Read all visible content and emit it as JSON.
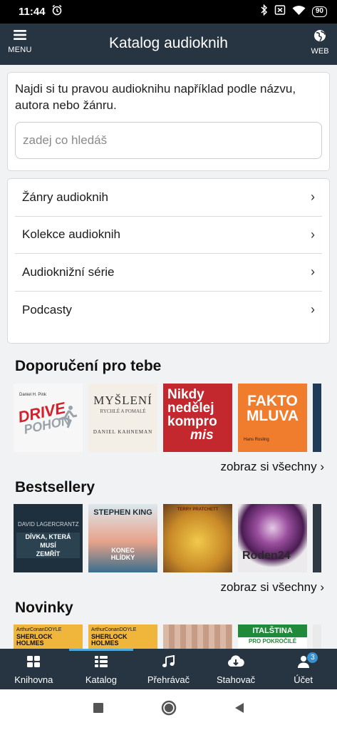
{
  "status": {
    "time": "11:44",
    "battery": "90"
  },
  "appbar": {
    "menu_label": "MENU",
    "title": "Katalog audioknih",
    "web_label": "WEB"
  },
  "search": {
    "intro": "Najdi si tu pravou audioknihu například podle názvu, autora nebo žánru.",
    "placeholder": "zadej co hledáš"
  },
  "nav": {
    "items": [
      {
        "label": "Žánry audioknih"
      },
      {
        "label": "Kolekce audioknih"
      },
      {
        "label": "Audioknižní série"
      },
      {
        "label": "Podcasty"
      }
    ]
  },
  "sections": [
    {
      "title": "Doporučení pro tebe",
      "see_all": "zobraz si všechny",
      "covers": [
        {
          "author": "Daniel H. Pink",
          "title_a": "DRIVE",
          "title_b": "POHON"
        },
        {
          "title_a": "MYŠLENÍ",
          "title_b": "RYCHLÉ A POMALÉ",
          "author": "DANIEL KAHNEMAN"
        },
        {
          "title_a": "Nikdy",
          "title_b": "nedělej",
          "title_c": "kompro",
          "title_d": "mis"
        },
        {
          "title_a": "FAKTO",
          "title_b": "MLUVA",
          "author": "Hans Rosling"
        }
      ]
    },
    {
      "title": "Bestsellery",
      "see_all": "zobraz si všechny",
      "covers": [
        {
          "author": "DAVID LAGERCRANTZ",
          "title_a": "DÍVKA, KTERÁ",
          "title_b": "MUSÍ",
          "title_c": "ZEMŘÍT"
        },
        {
          "author": "STEPHEN KING",
          "title_a": "KONEC",
          "title_b": "HLÍDKY"
        },
        {
          "author": "TERRY PRATCHETT"
        },
        {
          "title_a": "Roden24"
        }
      ]
    },
    {
      "title": "Novinky",
      "covers": [
        {
          "author": "ArthurConanDOYLE",
          "title_a": "SHERLOCK",
          "title_b": "HOLMES"
        },
        {
          "author": "ArthurConanDOYLE",
          "title_a": "SHERLOCK",
          "title_b": "HOLMES"
        },
        {
          "title_a": ""
        },
        {
          "title_a": "ITALŠTINA",
          "title_b": "PRO POKROČILÉ"
        }
      ]
    }
  ],
  "tabs": [
    {
      "label": "Knihovna",
      "icon": "grid-icon"
    },
    {
      "label": "Katalog",
      "icon": "list-icon"
    },
    {
      "label": "Přehrávač",
      "icon": "music-note-icon"
    },
    {
      "label": "Stahovač",
      "icon": "cloud-download-icon"
    },
    {
      "label": "Účet",
      "icon": "user-icon",
      "badge": "3"
    }
  ]
}
